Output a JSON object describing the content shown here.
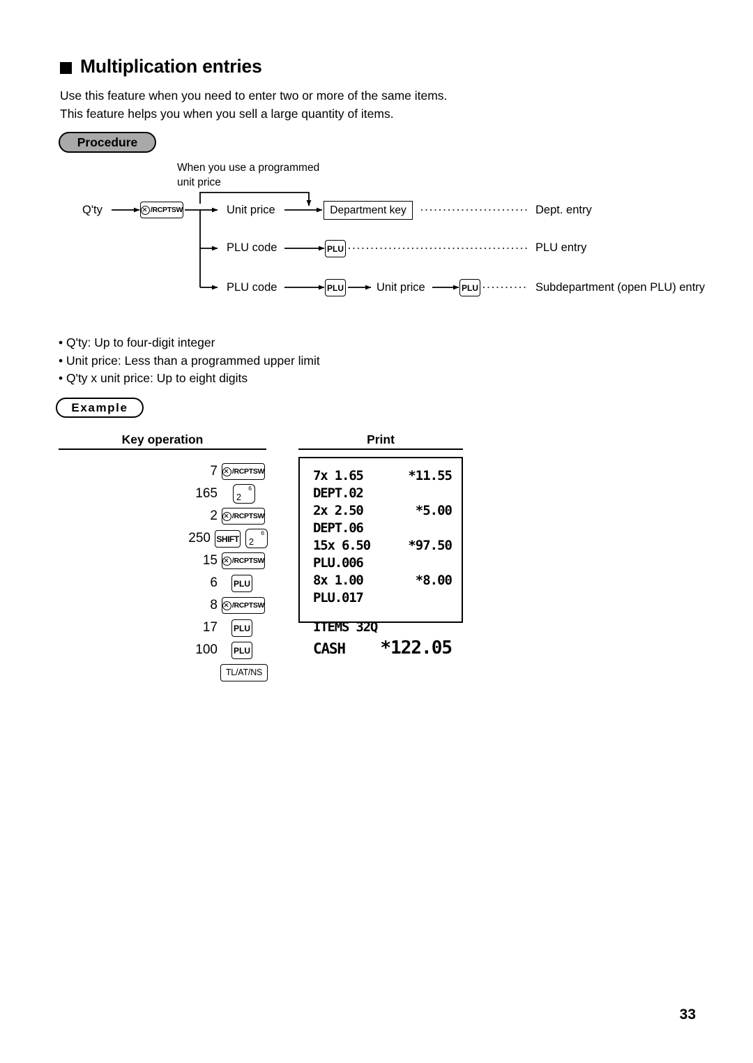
{
  "heading": {
    "bullet_icon": "filled-square-icon",
    "title": "Multiplication entries"
  },
  "intro": {
    "line1": "Use this feature when you need to enter two or more of the same items.",
    "line2": "This feature helps you when you sell a large quantity of items."
  },
  "badges": {
    "procedure": "Procedure",
    "example": "Example",
    "procedure_fill": "#a9a9a9",
    "example_fill": "#ffffff"
  },
  "diagram": {
    "note_line1": "When you use a programmed",
    "note_line2": "unit price",
    "qty_label": "Q'ty",
    "rcptsw_key": "/RCPTSW",
    "row1": {
      "input": "Unit price",
      "key": "Department key",
      "result": "Dept. entry"
    },
    "row2": {
      "input": "PLU code",
      "key": "PLU",
      "result": "PLU entry"
    },
    "row3": {
      "input": "PLU code",
      "key": "PLU",
      "input2": "Unit price",
      "key2": "PLU",
      "result": "Subdepartment (open PLU) entry"
    }
  },
  "notes": [
    "• Q'ty: Up to four-digit integer",
    "• Unit price: Less than a programmed upper limit",
    "• Q'ty x unit price: Up to eight digits"
  ],
  "example": {
    "col_key_operation": "Key operation",
    "col_print": "Print",
    "key_operation_rows": [
      {
        "num": "7",
        "keys": [
          {
            "type": "rcptsw",
            "label": "/RCPTSW"
          }
        ]
      },
      {
        "num": "165",
        "keys": [
          {
            "type": "dept",
            "main": "2",
            "sup": "6"
          }
        ]
      },
      {
        "num": "2",
        "keys": [
          {
            "type": "rcptsw",
            "label": "/RCPTSW"
          }
        ]
      },
      {
        "num": "250",
        "keys": [
          {
            "type": "shift",
            "label": "SHIFT"
          },
          {
            "type": "dept",
            "main": "2",
            "sup": "6"
          }
        ]
      },
      {
        "num": "15",
        "keys": [
          {
            "type": "rcptsw",
            "label": "/RCPTSW"
          }
        ]
      },
      {
        "num": "6",
        "keys": [
          {
            "type": "plu",
            "label": "PLU"
          }
        ]
      },
      {
        "num": "8",
        "keys": [
          {
            "type": "rcptsw",
            "label": "/RCPTSW"
          }
        ]
      },
      {
        "num": "17",
        "keys": [
          {
            "type": "plu",
            "label": "PLU"
          }
        ]
      },
      {
        "num": "100",
        "keys": [
          {
            "type": "plu",
            "label": "PLU"
          }
        ]
      },
      {
        "num": "",
        "keys": [
          {
            "type": "tlat",
            "label": "TL/AT/NS"
          }
        ]
      }
    ],
    "receipt": {
      "lines": [
        {
          "left": "7x 1.65",
          "right": "*11.55"
        },
        {
          "left": "DEPT.02",
          "right": ""
        },
        {
          "left": "2x 2.50",
          "right": "*5.00"
        },
        {
          "left": "DEPT.06",
          "right": ""
        },
        {
          "left": "15x 6.50",
          "right": "*97.50"
        },
        {
          "left": "PLU.006",
          "right": ""
        },
        {
          "left": "8x 1.00",
          "right": "*8.00"
        },
        {
          "left": "PLU.017",
          "right": ""
        }
      ],
      "items_label": "ITEMS 32Q",
      "total_label": "CASH",
      "total_amount": "*122.05"
    }
  },
  "page_number": "33"
}
